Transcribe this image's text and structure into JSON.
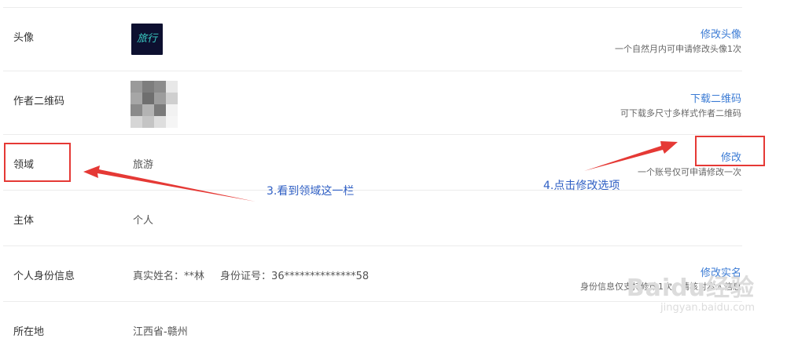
{
  "rows": {
    "avatar": {
      "label": "头像",
      "avatar_text": "旅行",
      "action": "修改头像",
      "hint": "一个自然月内可申请修改头像1次"
    },
    "qrcode": {
      "label": "作者二维码",
      "action": "下载二维码",
      "hint": "可下载多尺寸多样式作者二维码"
    },
    "domain": {
      "label": "领域",
      "value": "旅游",
      "action": "修改",
      "hint": "一个账号仅可申请修改一次"
    },
    "subject": {
      "label": "主体",
      "value": "个人"
    },
    "identity": {
      "label": "个人身份信息",
      "real_name_label": "真实姓名：",
      "real_name": "**林",
      "id_label": "身份证号：",
      "id_number": "36**************58",
      "action": "修改实名",
      "hint": "身份信息仅支持修改1次，请核对本人信息"
    },
    "location": {
      "label": "所在地",
      "value": "江西省-赣州"
    }
  },
  "annotations": {
    "step3": "3.看到领域这一栏",
    "step4": "4.点击修改选项"
  },
  "watermark": {
    "main": "Baidu经验",
    "sub": "jingyan.baidu.com"
  },
  "colors": {
    "link": "#3b7bd4",
    "annotation_red": "#e53935",
    "annotation_text": "#2f5fc4"
  }
}
